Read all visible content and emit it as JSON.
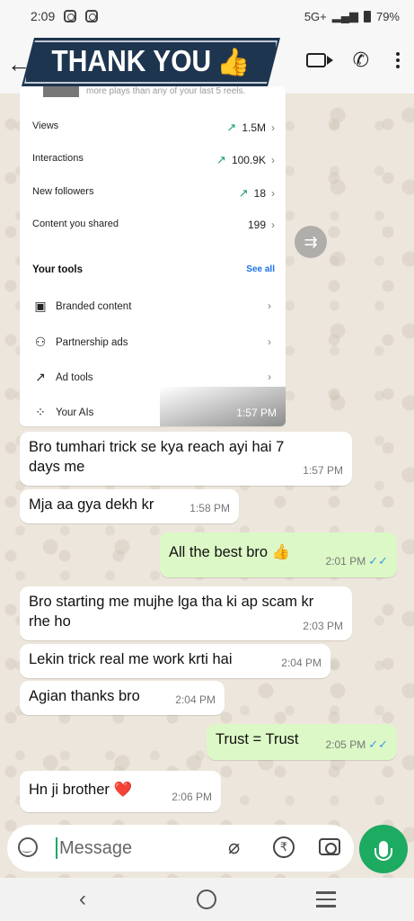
{
  "status_bar": {
    "time": "2:09",
    "network": "5G+",
    "battery": "79%"
  },
  "header": {
    "banner_text": "THANK YOU",
    "banner_emoji": "👍"
  },
  "screenshot": {
    "top_text": "more plays than any of your last 5 reels.",
    "stats": [
      {
        "label": "Views",
        "value": "1.5M",
        "trend": "↗"
      },
      {
        "label": "Interactions",
        "value": "100.9K",
        "trend": "↗"
      },
      {
        "label": "New followers",
        "value": "18",
        "trend": "↗"
      },
      {
        "label": "Content you shared",
        "value": "199",
        "trend": ""
      }
    ],
    "tools_title": "Your tools",
    "see_all": "See all",
    "tools": [
      {
        "label": "Branded content",
        "icon": "branded-content-icon"
      },
      {
        "label": "Partnership ads",
        "icon": "partnership-ads-icon"
      },
      {
        "label": "Ad tools",
        "icon": "ad-tools-icon"
      },
      {
        "label": "Your AIs",
        "icon": "ai-icon"
      }
    ],
    "time": "1:57 PM"
  },
  "messages": [
    {
      "dir": "in",
      "text": "Bro tumhari trick se kya reach ayi hai 7 days me",
      "time": "1:57 PM"
    },
    {
      "dir": "in",
      "text": "Mja aa gya dekh kr",
      "time": "1:58 PM"
    },
    {
      "dir": "out",
      "text": "All the best bro 👍",
      "time": "2:01 PM"
    },
    {
      "dir": "in",
      "text": "Bro starting me mujhe lga tha ki ap scam kr rhe ho",
      "time": "2:03 PM"
    },
    {
      "dir": "in",
      "text": "Lekin trick real me work krti hai",
      "time": "2:04 PM"
    },
    {
      "dir": "in",
      "text": "Agian thanks bro",
      "time": "2:04 PM"
    },
    {
      "dir": "out",
      "text": "Trust = Trust",
      "time": "2:05 PM"
    },
    {
      "dir": "in",
      "text": "Hn ji brother ❤️",
      "time": "2:06 PM"
    }
  ],
  "composer": {
    "placeholder": "Message"
  },
  "colors": {
    "outgoing_bubble": "#DCF8C6",
    "accent_green": "#1DAA61",
    "read_ticks": "#3A9BDC",
    "banner_bg": "#1E3550"
  }
}
